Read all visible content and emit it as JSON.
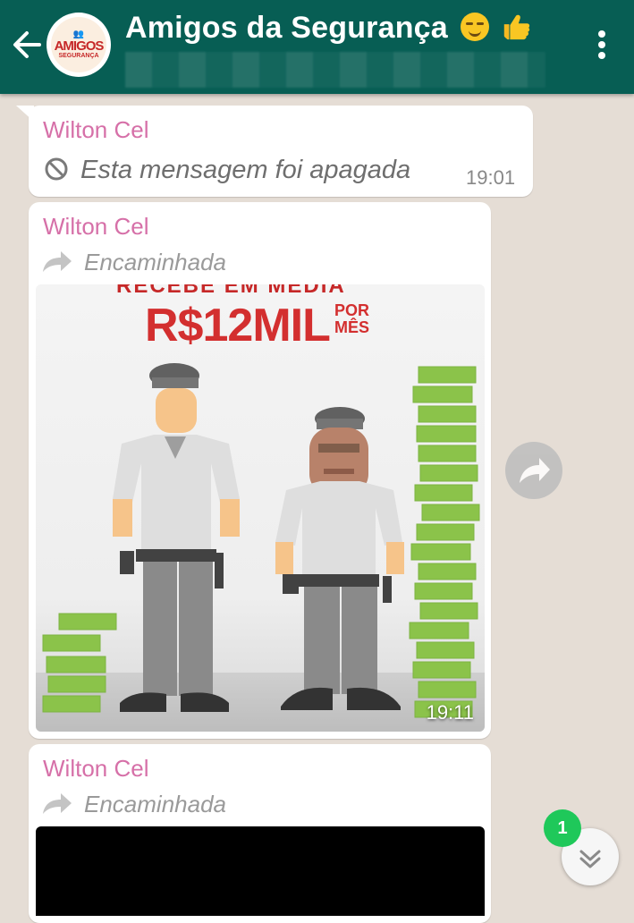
{
  "header": {
    "title": "Amigos da Segurança",
    "avatar_text_1": "AMIGOS",
    "avatar_text_2": "SEGURANÇA",
    "subtitle": "A"
  },
  "messages": [
    {
      "sender": "Wilton Cel",
      "type": "deleted",
      "text": "Esta mensagem foi apagada",
      "time": "19:01"
    },
    {
      "sender": "Wilton Cel",
      "type": "forwarded-image",
      "forwarded_label": "Encaminhada",
      "image_headline_top": "RECEBE EM MÉDIA",
      "image_headline_main": "R$12MIL",
      "image_headline_sub_1": "POR",
      "image_headline_sub_2": "MÊS",
      "time": "19:11"
    },
    {
      "sender": "Wilton Cel",
      "type": "forwarded-media",
      "forwarded_label": "Encaminhada"
    }
  ],
  "unread_count": "1",
  "colors": {
    "header": "#075e54",
    "chat_background": "#e5ddd5",
    "sender_name": "#d670a8",
    "unread_badge": "#1fc85a",
    "money": "#8bc34a"
  },
  "icons": [
    "back-arrow-icon",
    "more-vert-icon",
    "blocked-icon",
    "forward-icon",
    "share-icon",
    "double-chevron-down-icon"
  ]
}
